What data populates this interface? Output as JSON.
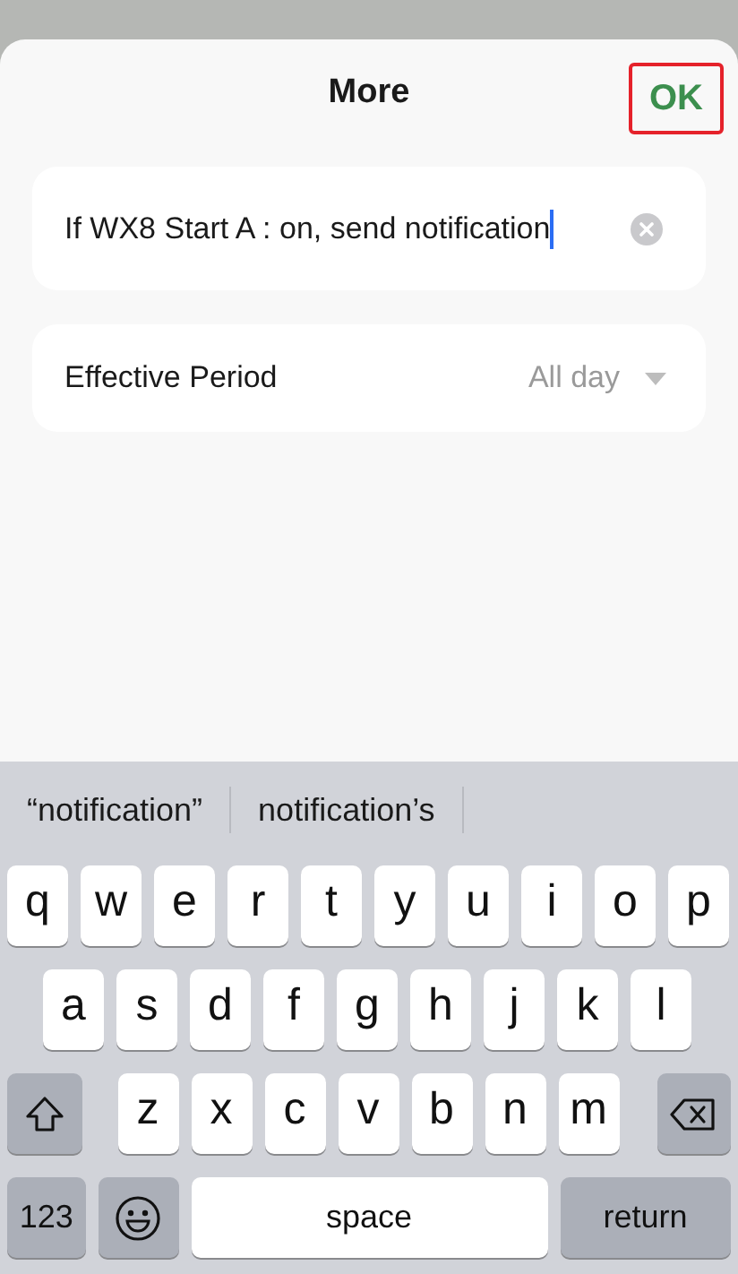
{
  "sheet": {
    "title": "More",
    "ok_button": "OK"
  },
  "message_field": {
    "value": "If WX8 Start A : on, send notification",
    "focused": true
  },
  "effective_period": {
    "label": "Effective Period",
    "value": "All day"
  },
  "keyboard": {
    "suggestions": [
      "“notification”",
      "notification’s"
    ],
    "letter_rows": [
      [
        "q",
        "w",
        "e",
        "r",
        "t",
        "y",
        "u",
        "i",
        "o",
        "p"
      ],
      [
        "a",
        "s",
        "d",
        "f",
        "g",
        "h",
        "j",
        "k",
        "l"
      ],
      [
        "z",
        "x",
        "c",
        "v",
        "b",
        "n",
        "m"
      ]
    ],
    "bottom_row": [
      {
        "kind": "numbers",
        "label": "123"
      },
      {
        "kind": "emoji"
      },
      {
        "kind": "space",
        "label": "space"
      },
      {
        "kind": "return",
        "label": "return"
      }
    ]
  }
}
